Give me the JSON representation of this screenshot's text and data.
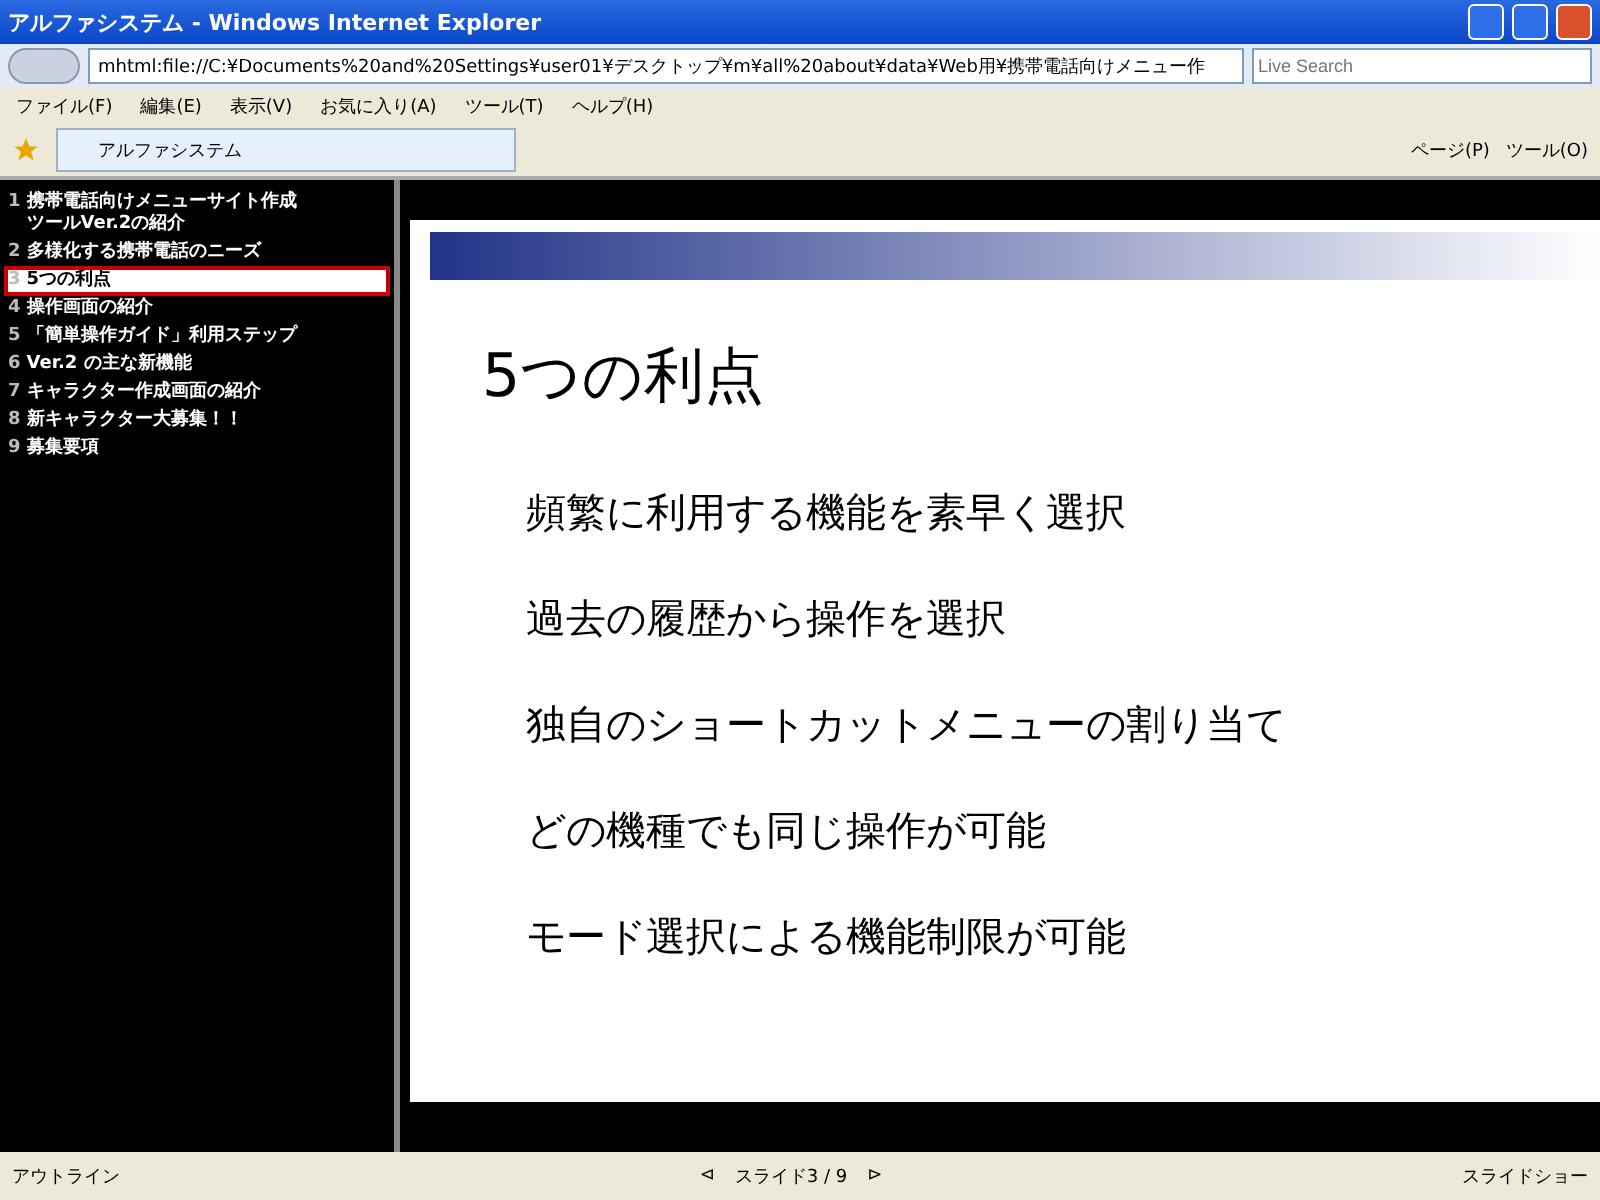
{
  "window": {
    "title": "アルファシステム - Windows Internet Explorer"
  },
  "address": {
    "value": "mhtml:file://C:¥Documents%20and%20Settings¥user01¥デスクトップ¥m¥all%20about¥data¥Web用¥携帯電話向けメニュー作"
  },
  "search": {
    "placeholder": "Live Search"
  },
  "menu": [
    "ファイル(F)",
    "編集(E)",
    "表示(V)",
    "お気に入り(A)",
    "ツール(T)",
    "ヘルプ(H)"
  ],
  "tab": {
    "label": "アルファシステム",
    "selected": true
  },
  "command_bar": [
    {
      "label": "ページ(P)"
    },
    {
      "label": "ツール(O)"
    }
  ],
  "outline": [
    {
      "number": "1",
      "label": "携帯電話向けメニューサイト作成ツールVer.2の紹介",
      "selected": false
    },
    {
      "number": "2",
      "label": "多様化する携帯電話のニーズ",
      "selected": false
    },
    {
      "number": "3",
      "label": "5つの利点",
      "selected": true
    },
    {
      "number": "4",
      "label": "操作画面の紹介",
      "selected": false
    },
    {
      "number": "5",
      "label": "「簡単操作ガイド」利用ステップ",
      "selected": false
    },
    {
      "number": "6",
      "label": "Ver.2 の主な新機能",
      "selected": false
    },
    {
      "number": "7",
      "label": "キャラクター作成画面の紹介",
      "selected": false
    },
    {
      "number": "8",
      "label": "新キャラクター大募集！！",
      "selected": false
    },
    {
      "number": "9",
      "label": "募集要項",
      "selected": false
    }
  ],
  "slide": {
    "title": "5つの利点",
    "bullets": [
      "頻繁に利用する機能を素早く選択",
      "過去の履歴から操作を選択",
      "独自のショートカットメニューの割り当て",
      "どの機種でも同じ操作が可能",
      "モード選択による機能制限が可能"
    ]
  },
  "status_bar": {
    "outline_label": "アウトライン",
    "prev": "⊲",
    "counter": "スライド3 / 9",
    "next": "⊳",
    "slideshow": "スライドショー"
  }
}
